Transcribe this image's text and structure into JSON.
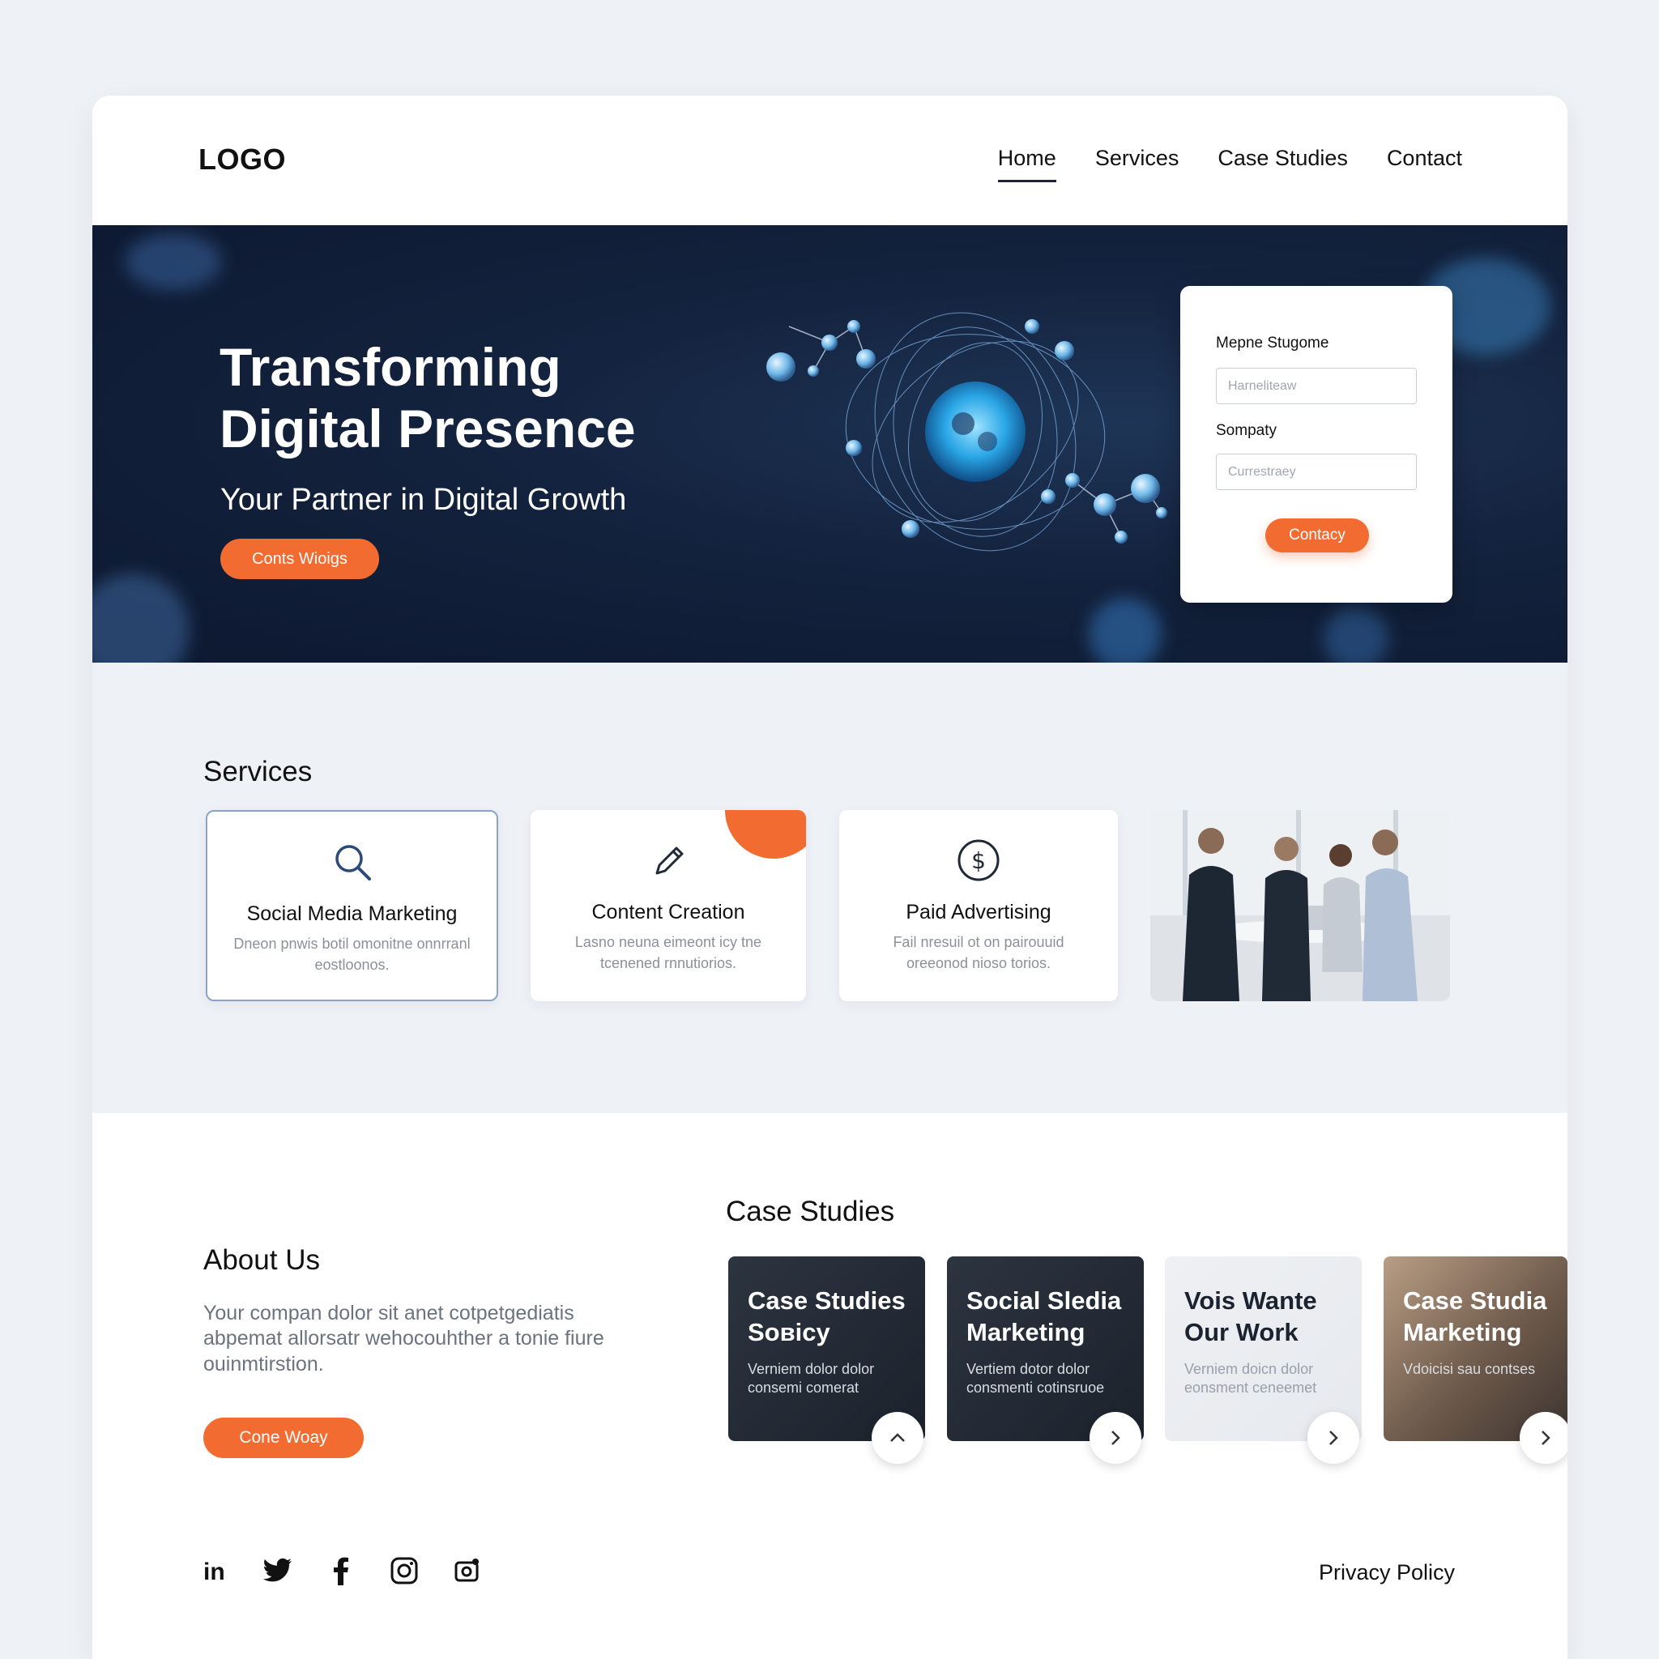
{
  "header": {
    "logo": "LOGO",
    "nav": [
      {
        "label": "Home",
        "active": true
      },
      {
        "label": "Services",
        "active": false
      },
      {
        "label": "Case Studies",
        "active": false
      },
      {
        "label": "Contact",
        "active": false
      }
    ]
  },
  "hero": {
    "title_line1": "Transforming",
    "title_line2": "Digital Presence",
    "subtitle": "Your Partner in Digital Growth",
    "cta_label": "Conts Wioigs"
  },
  "contact_form": {
    "field1_label": "Mepne Stugome",
    "field1_placeholder": "Harneliteaw",
    "field2_label": "Sompaty",
    "field2_placeholder": "Currestraey",
    "submit_label": "Contacy"
  },
  "services": {
    "title": "Services",
    "cards": [
      {
        "icon": "search-icon",
        "title": "Social Media Marketing",
        "desc": "Dneon pnwis botil omonitne onnrranl eostloonos."
      },
      {
        "icon": "pencil-icon",
        "title": "Content Creation",
        "desc": "Lasno neuna eimeont icy tne tcenened rnnutiorios."
      },
      {
        "icon": "dollar-icon",
        "title": "Paid Advertising",
        "desc": "Fail nresuil ot on pairouuid oreeonod nioso torios."
      }
    ]
  },
  "about": {
    "title": "About Us",
    "desc": "Your compan dolor sit anet cotpetgediatis abpemat allorsatr wehocouhther a tonie fiure ouinmtirstion.",
    "cta_label": "Cone Woay"
  },
  "case_studies": {
    "title": "Case Studies",
    "cards": [
      {
        "title": "Case Studies Soвicy",
        "desc": "Verniem dolor dolor consemi comerat",
        "nav": "chevron-up-icon"
      },
      {
        "title": "Social Sledia Marketing",
        "desc": "Vertiem dotor dolor consmenti cotinsruoe",
        "nav": "chevron-right-icon"
      },
      {
        "title": "Vois Wante Our Work",
        "desc": "Verniem doicn dolor eonsment ceneemet",
        "nav": "chevron-right-icon"
      },
      {
        "title": "Case Studia Marketing",
        "desc": "Vdoicisi sau contses",
        "nav": "chevron-right-icon"
      }
    ]
  },
  "footer": {
    "social": [
      "linkedin-icon",
      "twitter-icon",
      "facebook-icon",
      "instagram-icon",
      "camera-icon"
    ],
    "privacy": "Privacy Policy"
  },
  "colors": {
    "accent": "#f26b30",
    "hero_bg": "#0d1830",
    "text": "#111827"
  }
}
